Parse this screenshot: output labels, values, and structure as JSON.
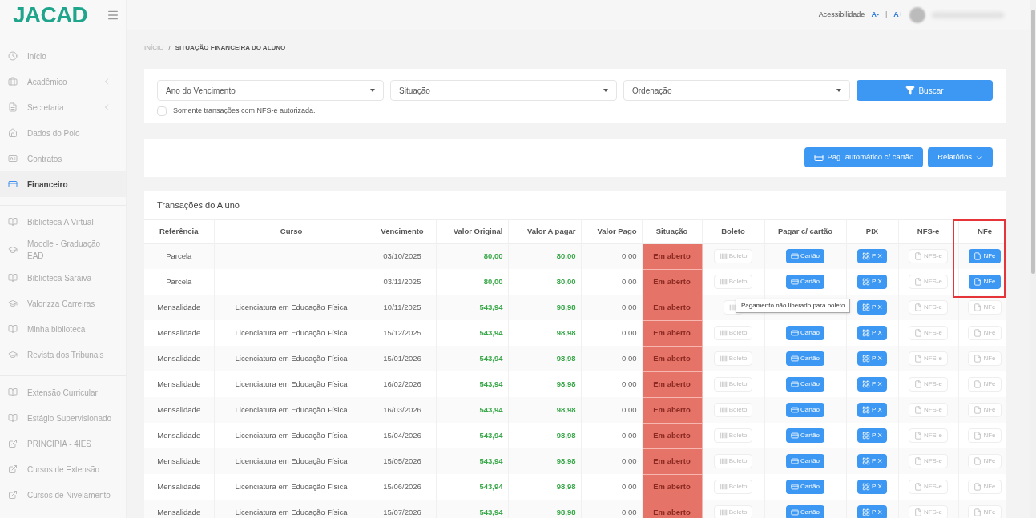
{
  "header": {
    "logo": "JACAD",
    "accessibility": {
      "label": "Acessibilidade",
      "decrease": "A-",
      "separator": "|",
      "increase": "A+"
    }
  },
  "sidebar": {
    "groups": [
      [
        {
          "label": "Início",
          "kind": "clock",
          "selected": false,
          "submenu": false
        },
        {
          "label": "Acadêmico",
          "kind": "briefcase",
          "selected": false,
          "submenu": true
        },
        {
          "label": "Secretaria",
          "kind": "file",
          "selected": false,
          "submenu": true
        },
        {
          "label": "Dados do Polo",
          "kind": "home",
          "selected": false,
          "submenu": false
        },
        {
          "label": "Contratos",
          "kind": "card",
          "selected": false,
          "submenu": false
        },
        {
          "label": "Financeiro",
          "kind": "money",
          "selected": true,
          "submenu": false
        }
      ],
      [
        {
          "label": "Biblioteca A Virtual",
          "kind": "book",
          "selected": false,
          "submenu": false
        },
        {
          "label": "Moodle - Graduação EAD",
          "kind": "cap",
          "selected": false,
          "submenu": false
        },
        {
          "label": "Biblioteca Saraiva",
          "kind": "book",
          "selected": false,
          "submenu": false
        },
        {
          "label": "Valorizza Carreiras",
          "kind": "cap",
          "selected": false,
          "submenu": false
        },
        {
          "label": "Minha biblioteca",
          "kind": "book",
          "selected": false,
          "submenu": false
        },
        {
          "label": "Revista dos Tribunais",
          "kind": "cap",
          "selected": false,
          "submenu": false
        }
      ],
      [
        {
          "label": "Extensão Curricular",
          "kind": "book",
          "selected": false,
          "submenu": false
        },
        {
          "label": "Estágio Supervisionado",
          "kind": "book",
          "selected": false,
          "submenu": false
        },
        {
          "label": "PRINCIPIA - 4IES",
          "kind": "external",
          "selected": false,
          "submenu": false
        },
        {
          "label": "Cursos de Extensão",
          "kind": "external",
          "selected": false,
          "submenu": false
        },
        {
          "label": "Cursos de Nivelamento",
          "kind": "external",
          "selected": false,
          "submenu": false
        }
      ]
    ]
  },
  "breadcrumb": {
    "home": "INÍCIO",
    "separator": "/",
    "current": "SITUAÇÃO FINANCEIRA DO ALUNO"
  },
  "filters": {
    "selects": [
      "Ano do Vencimento",
      "Situação",
      "Ordenação"
    ],
    "search_button": "Buscar",
    "nfse_only": {
      "label": "Somente transações com NFS-e autorizada.",
      "checked": false
    }
  },
  "actions": {
    "auto_pay_button": "Pag. automático c/ cartão",
    "reports_button": "Relatórios"
  },
  "table": {
    "title": "Transações do Aluno",
    "columns": [
      {
        "label": "Referência",
        "highlighted": false
      },
      {
        "label": "Curso",
        "highlighted": false
      },
      {
        "label": "Vencimento",
        "highlighted": false
      },
      {
        "label": "Valor Original",
        "highlighted": false
      },
      {
        "label": "Valor A pagar",
        "highlighted": false
      },
      {
        "label": "Valor Pago",
        "highlighted": false
      },
      {
        "label": "Situação",
        "highlighted": false
      },
      {
        "label": "Boleto",
        "highlighted": false
      },
      {
        "label": "Pagar c/ cartão",
        "highlighted": false
      },
      {
        "label": "PIX",
        "highlighted": false
      },
      {
        "label": "NFS-e",
        "highlighted": false
      },
      {
        "label": "NFe",
        "highlighted": true
      }
    ],
    "rows": [
      {
        "reference": "Parcela",
        "due": "03/10/2025",
        "original": "80,00",
        "to_pay": "80,00",
        "paid": "0,00",
        "status": "Em aberto",
        "boleto": {
          "label": "Boleto",
          "enabled": false
        },
        "card": "Cartão",
        "pix": "PIX",
        "nfse": {
          "label": "NFS-e",
          "enabled": false
        },
        "nfe": {
          "label": "NFe",
          "enabled": true
        }
      },
      {
        "reference": "Parcela",
        "due": "03/11/2025",
        "original": "80,00",
        "to_pay": "80,00",
        "paid": "0,00",
        "status": "Em aberto",
        "boleto": {
          "label": "Boleto",
          "enabled": false
        },
        "card": "Cartão",
        "pix": "PIX",
        "nfse": {
          "label": "NFS-e",
          "enabled": false
        },
        "nfe": {
          "label": "NFe",
          "enabled": true
        }
      },
      {
        "reference": "Mensalidade",
        "course": "Licenciatura em Educação Física",
        "due": "10/11/2025",
        "original": "543,94",
        "to_pay": "98,98",
        "paid": "0,00",
        "status": "Em aberto",
        "boleto": {
          "enabled": false,
          "tooltip": "Pagamento não liberado para boleto"
        },
        "pix": "PIX",
        "nfse": {
          "label": "NFS-e",
          "enabled": false
        },
        "nfe": {
          "label": "NFe",
          "enabled": false
        }
      },
      {
        "reference": "Mensalidade",
        "course": "Licenciatura em Educação Física",
        "due": "15/12/2025",
        "original": "543,94",
        "to_pay": "98,98",
        "paid": "0,00",
        "status": "Em aberto",
        "boleto": {
          "label": "Boleto",
          "enabled": false
        },
        "card": "Cartão",
        "pix": "PIX",
        "nfse": {
          "label": "NFS-e",
          "enabled": false
        },
        "nfe": {
          "label": "NFe",
          "enabled": false
        }
      },
      {
        "reference": "Mensalidade",
        "course": "Licenciatura em Educação Física",
        "due": "15/01/2026",
        "original": "543,94",
        "to_pay": "98,98",
        "paid": "0,00",
        "status": "Em aberto",
        "boleto": {
          "label": "Boleto",
          "enabled": false
        },
        "card": "Cartão",
        "pix": "PIX",
        "nfse": {
          "label": "NFS-e",
          "enabled": false
        },
        "nfe": {
          "label": "NFe",
          "enabled": false
        }
      },
      {
        "reference": "Mensalidade",
        "course": "Licenciatura em Educação Física",
        "due": "16/02/2026",
        "original": "543,94",
        "to_pay": "98,98",
        "paid": "0,00",
        "status": "Em aberto",
        "boleto": {
          "label": "Boleto",
          "enabled": false
        },
        "card": "Cartão",
        "pix": "PIX",
        "nfse": {
          "label": "NFS-e",
          "enabled": false
        },
        "nfe": {
          "label": "NFe",
          "enabled": false
        }
      },
      {
        "reference": "Mensalidade",
        "course": "Licenciatura em Educação Física",
        "due": "16/03/2026",
        "original": "543,94",
        "to_pay": "98,98",
        "paid": "0,00",
        "status": "Em aberto",
        "boleto": {
          "label": "Boleto",
          "enabled": false
        },
        "card": "Cartão",
        "pix": "PIX",
        "nfse": {
          "label": "NFS-e",
          "enabled": false
        },
        "nfe": {
          "label": "NFe",
          "enabled": false
        }
      },
      {
        "reference": "Mensalidade",
        "course": "Licenciatura em Educação Física",
        "due": "15/04/2026",
        "original": "543,94",
        "to_pay": "98,98",
        "paid": "0,00",
        "status": "Em aberto",
        "boleto": {
          "label": "Boleto",
          "enabled": false
        },
        "card": "Cartão",
        "pix": "PIX",
        "nfse": {
          "label": "NFS-e",
          "enabled": false
        },
        "nfe": {
          "label": "NFe",
          "enabled": false
        }
      },
      {
        "reference": "Mensalidade",
        "course": "Licenciatura em Educação Física",
        "due": "15/05/2026",
        "original": "543,94",
        "to_pay": "98,98",
        "paid": "0,00",
        "status": "Em aberto",
        "boleto": {
          "label": "Boleto",
          "enabled": false
        },
        "card": "Cartão",
        "pix": "PIX",
        "nfse": {
          "label": "NFS-e",
          "enabled": false
        },
        "nfe": {
          "label": "NFe",
          "enabled": false
        }
      },
      {
        "reference": "Mensalidade",
        "course": "Licenciatura em Educação Física",
        "due": "15/06/2026",
        "original": "543,94",
        "to_pay": "98,98",
        "paid": "0,00",
        "status": "Em aberto",
        "boleto": {
          "label": "Boleto",
          "enabled": false
        },
        "card": "Cartão",
        "pix": "PIX",
        "nfse": {
          "label": "NFS-e",
          "enabled": false
        },
        "nfe": {
          "label": "NFe",
          "enabled": false
        }
      },
      {
        "reference": "Mensalidade",
        "course": "Licenciatura em Educação Física",
        "due": "15/07/2026",
        "original": "543,94",
        "to_pay": "98,98",
        "paid": "0,00",
        "status": "Em aberto",
        "boleto": {
          "label": "Boleto",
          "enabled": false
        },
        "card": "Cartão",
        "pix": "PIX",
        "nfse": {
          "label": "NFS-e",
          "enabled": false
        },
        "nfe": {
          "label": "NFe",
          "enabled": false
        }
      }
    ]
  }
}
